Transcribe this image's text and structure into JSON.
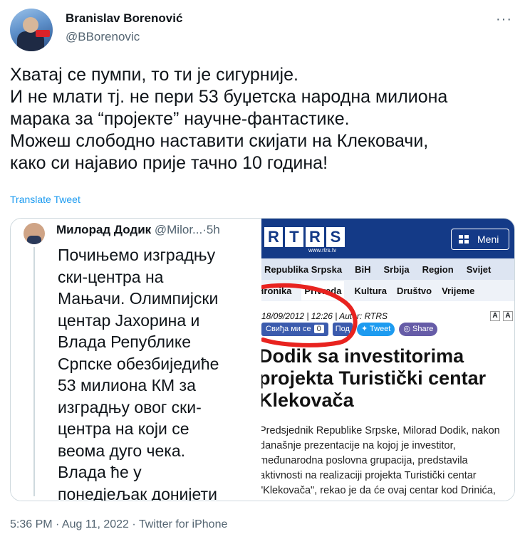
{
  "author": {
    "name": "Branislav Borenović",
    "handle": "@BBorenovic"
  },
  "tweet": {
    "lines": [
      "Хватај се пумпи, то ти је сигурније.",
      "И не млати тј. не пери 53 буџетска народна милиона",
      "марака за “пројекте” научне-фантастике.",
      "Можеш слободно наставити скијати на Клековачи,",
      "како си најавио прије тачно 10 година!"
    ],
    "translate": "Translate Tweet",
    "timestamp": "5:36 PM · Aug 11, 2022 · Twitter for iPhone"
  },
  "quoted": {
    "name": "Милорад Додик",
    "handle": "@Milor...",
    "age": "·5h",
    "lines": [
      "Почињемо изградњу",
      "ски-центра на",
      "Мањачи. Олимпијски",
      "центар Јахорина и",
      "Влада Републике",
      "Српске обезбиједиће",
      "53 милиона КМ за",
      "изградњу овог ски-",
      "центра на који се",
      "веома дуго чека.",
      "Влада ће у",
      "понедјељак донијети"
    ]
  },
  "article": {
    "logo": [
      "R",
      "T",
      "R",
      "S"
    ],
    "site": "www.rtrs.tv",
    "menu": "Meni",
    "nav_top": [
      "Republika Srpska",
      "BiH",
      "Srbija",
      "Region",
      "Svijet"
    ],
    "nav_bottom": [
      "Hronika",
      "Privreda",
      "Kultura",
      "Društvo",
      "Vrijeme"
    ],
    "dateline": "18/09/2012 | 12:26 | Autor: RTRS",
    "fb_label": "Свиђа ми се",
    "fb_count": "0",
    "small_btn": "Под",
    "tweet_btn": "Tweet",
    "share_btn": "Share",
    "font_buttons": [
      "A",
      "A"
    ],
    "headline_lines": [
      "Dodik sa investitorima",
      "projekta Turistički centar",
      "Klekovača"
    ],
    "body_lines": [
      "Predsjednik Republike Srpske, Milorad Dodik, nakon",
      "današnje prezentacije na kojoj je investitor,",
      "međunarodna poslovna grupacija, predstavila",
      "aktivnosti na realizaciji projekta Turistički centar",
      "\"Klekovača\", rekao je da će ovaj centar kod Drinića,"
    ]
  },
  "colors": {
    "link": "#1d9bf0",
    "rtrs_blue": "#143a87",
    "annotation_red": "#e8231f"
  }
}
